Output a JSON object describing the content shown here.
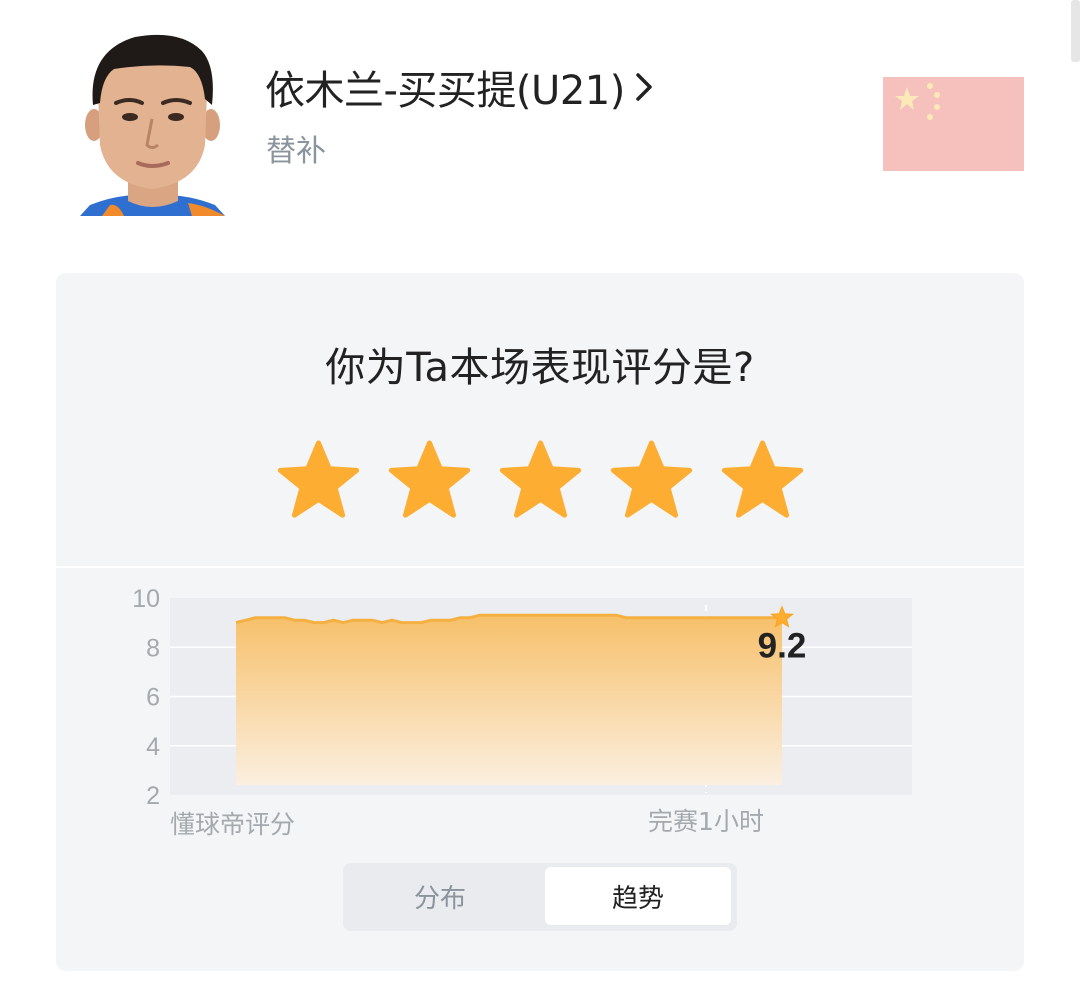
{
  "player": {
    "name": "依木兰-买买提(U21)",
    "role": "替补"
  },
  "flag": {
    "country": "China",
    "colors": {
      "field": "#f6c1bd",
      "stars": "#fbe9b8"
    }
  },
  "rating": {
    "question": "你为Ta本场表现评分是?",
    "stars_selected": 5,
    "stars_total": 5,
    "star_color": "#fcad32"
  },
  "chart_data": {
    "type": "area",
    "ylim": [
      2,
      10
    ],
    "yticks": [
      10,
      8,
      6,
      4,
      2
    ],
    "x_labels": [
      "懂球帝评分",
      "完赛1小时"
    ],
    "series": [
      {
        "values": [
          9.0,
          9.1,
          9.2,
          9.2,
          9.2,
          9.2,
          9.1,
          9.1,
          9.0,
          9.0,
          9.1,
          9.0,
          9.1,
          9.1,
          9.1,
          9.0,
          9.1,
          9.0,
          9.0,
          9.0,
          9.1,
          9.1,
          9.1,
          9.2,
          9.2,
          9.3,
          9.3,
          9.3,
          9.3,
          9.3,
          9.3,
          9.3,
          9.3,
          9.3,
          9.3,
          9.3,
          9.3,
          9.3,
          9.3,
          9.3,
          9.2,
          9.2,
          9.2,
          9.2,
          9.2,
          9.2,
          9.2,
          9.2,
          9.2,
          9.2,
          9.2,
          9.2,
          9.2,
          9.2,
          9.2,
          9.2,
          9.2
        ]
      }
    ],
    "final_value_label": "9.2",
    "colors": {
      "line": "#f5b042",
      "fill_top": "#f7c06a",
      "fill_bottom": "#fbefe0",
      "plot_bg": "#ebedf0",
      "grid": "#ffffff"
    }
  },
  "tabs": {
    "distribution": "分布",
    "trend": "趋势",
    "active": "trend"
  }
}
